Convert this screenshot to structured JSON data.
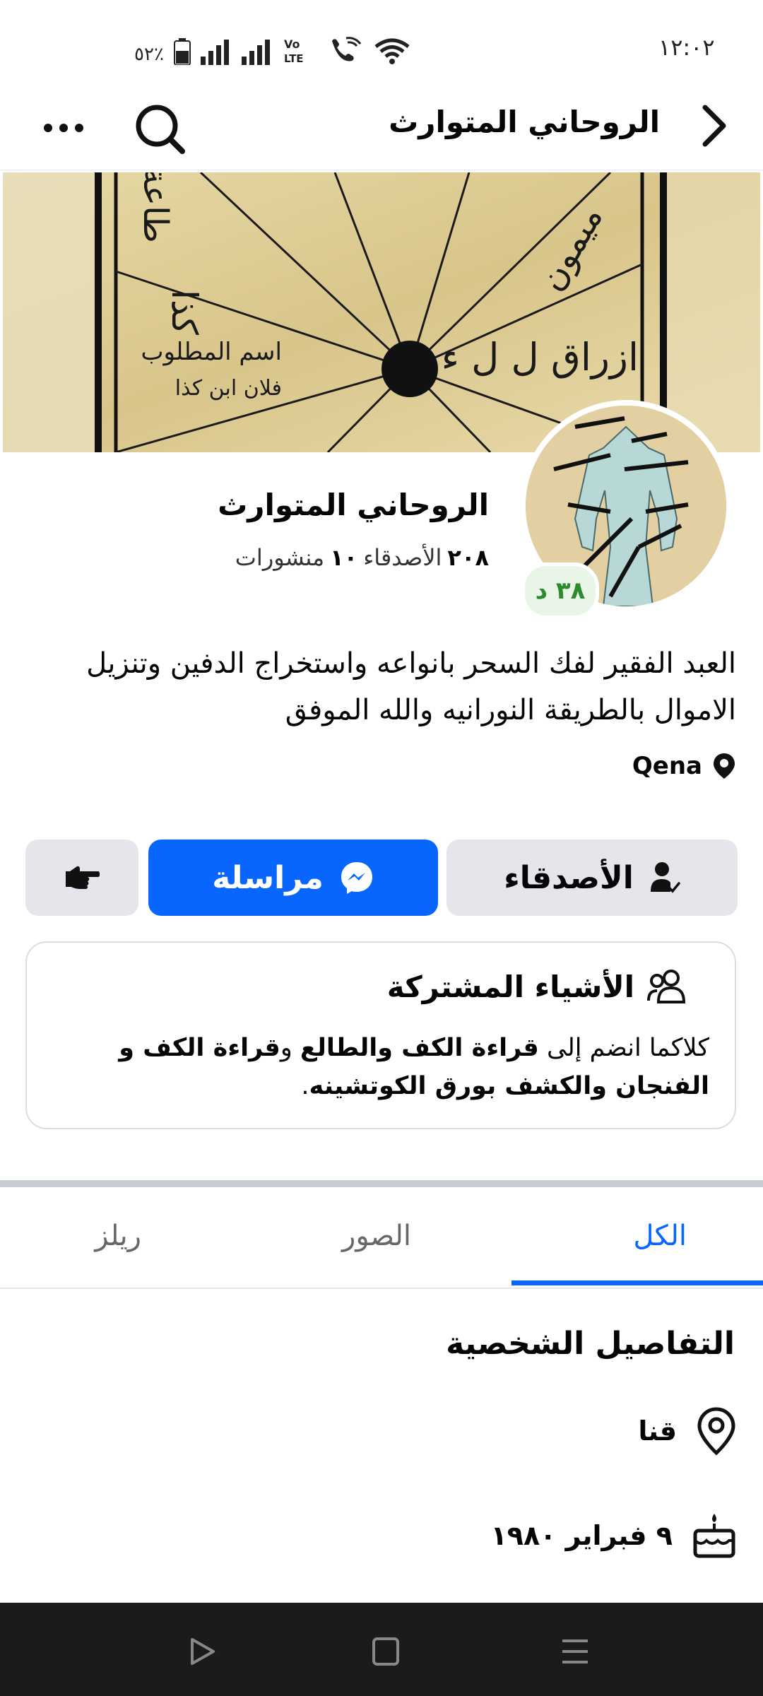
{
  "status_bar": {
    "time": "١٢:٠٢",
    "battery": "٥٢٪",
    "network_label": "Vo LTE"
  },
  "top_bar": {
    "title": "الروحاني المتوارث"
  },
  "profile": {
    "name": "الروحاني المتوارث",
    "friends_count": "٢٠٨",
    "friends_label": "الأصدقاء",
    "posts_count": "١٠",
    "posts_label": "منشورات",
    "time_badge": "٣٨ د",
    "bio": "العبد الفقير لفك السحر بانواعه واستخراج الدفين وتنزيل الاموال بالطريقة النورانيه والله الموفق",
    "location": "Qena"
  },
  "cover_text": {
    "c1": "اسم المطلوب",
    "c2": "فلان ابن كذا",
    "c3": "ازراق ل ل ء",
    "c4": "طاعة",
    "c5": "كذا",
    "c6": "ميمون"
  },
  "actions": {
    "friends_label": "الأصدقاء",
    "message_label": "مراسلة"
  },
  "mutual": {
    "title": "الأشياء المشتركة",
    "prefix": "كلاكما انضم إلى ",
    "group1": "قراءة الكف والطالع",
    "conj": " و",
    "group2": "قراءة الكف و الفنجان والكشف بورق الكوتشينه",
    "suffix": "."
  },
  "tabs": {
    "all": "الكل",
    "photos": "الصور",
    "reels": "ريلز"
  },
  "details": {
    "title": "التفاصيل الشخصية",
    "city": "قنا",
    "birthday": "٩ فبراير ١٩٨٠"
  },
  "colors": {
    "accent": "#0866ff",
    "button_gray": "#e4e6eb",
    "badge_green": "#2e8a2e"
  }
}
